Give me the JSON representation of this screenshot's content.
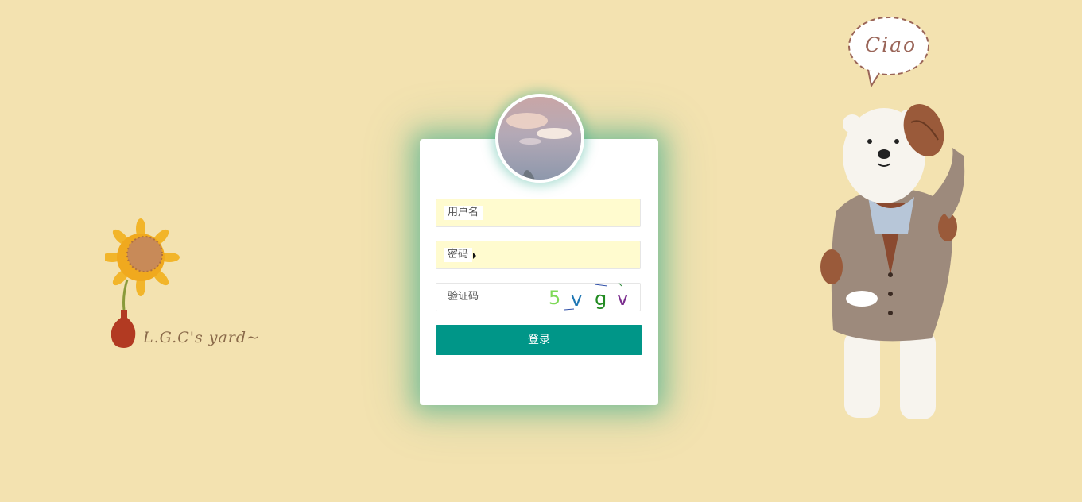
{
  "form": {
    "username_placeholder": "用户名",
    "password_placeholder": "密码",
    "captcha_placeholder": "验证码",
    "captcha_chars": [
      "5",
      "v",
      "g",
      "v"
    ],
    "captcha_colors": [
      "#7ed957",
      "#1f77b4",
      "#228b22",
      "#7b2d8e"
    ],
    "login_label": "登录"
  },
  "decor": {
    "yard_text": "L.G.C's yard~",
    "speech_text": "Ciao"
  },
  "colors": {
    "background": "#f3e2b0",
    "primary": "#009688",
    "autofill": "#fffbcf"
  },
  "icons": {
    "avatar": "avatar-photo",
    "left_art": "sunflower-vase-illustration",
    "right_art": "polar-bear-illustration"
  }
}
